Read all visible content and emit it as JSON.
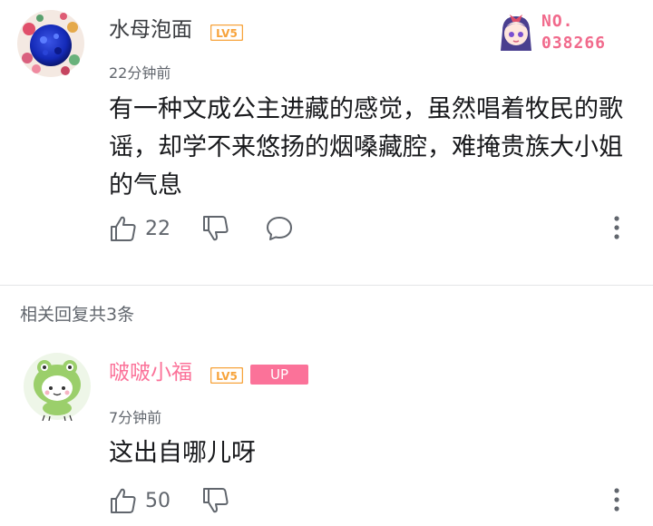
{
  "main_comment": {
    "username": "水母泡面",
    "level": "LV5",
    "time": "22分钟前",
    "text": "有一种文成公主进藏的感觉，虽然唱着牧民的歌谣，却学不来悠扬的烟嗓藏腔，难掩贵族大小姐的气息",
    "likes": "22",
    "badge": {
      "label": "NO.",
      "number": "038266"
    }
  },
  "replies_header": "相关回复共3条",
  "reply": {
    "username": "啵啵小福",
    "level": "LV5",
    "up_label": "UP",
    "time": "7分钟前",
    "text": "这出自哪儿呀",
    "likes": "50"
  },
  "colors": {
    "accent": "#fb7299",
    "level_orange": "#f7a33b",
    "icon_gray": "#61666d"
  },
  "icons": [
    "thumbs-up-icon",
    "thumbs-down-icon",
    "comment-icon",
    "more-icon"
  ]
}
